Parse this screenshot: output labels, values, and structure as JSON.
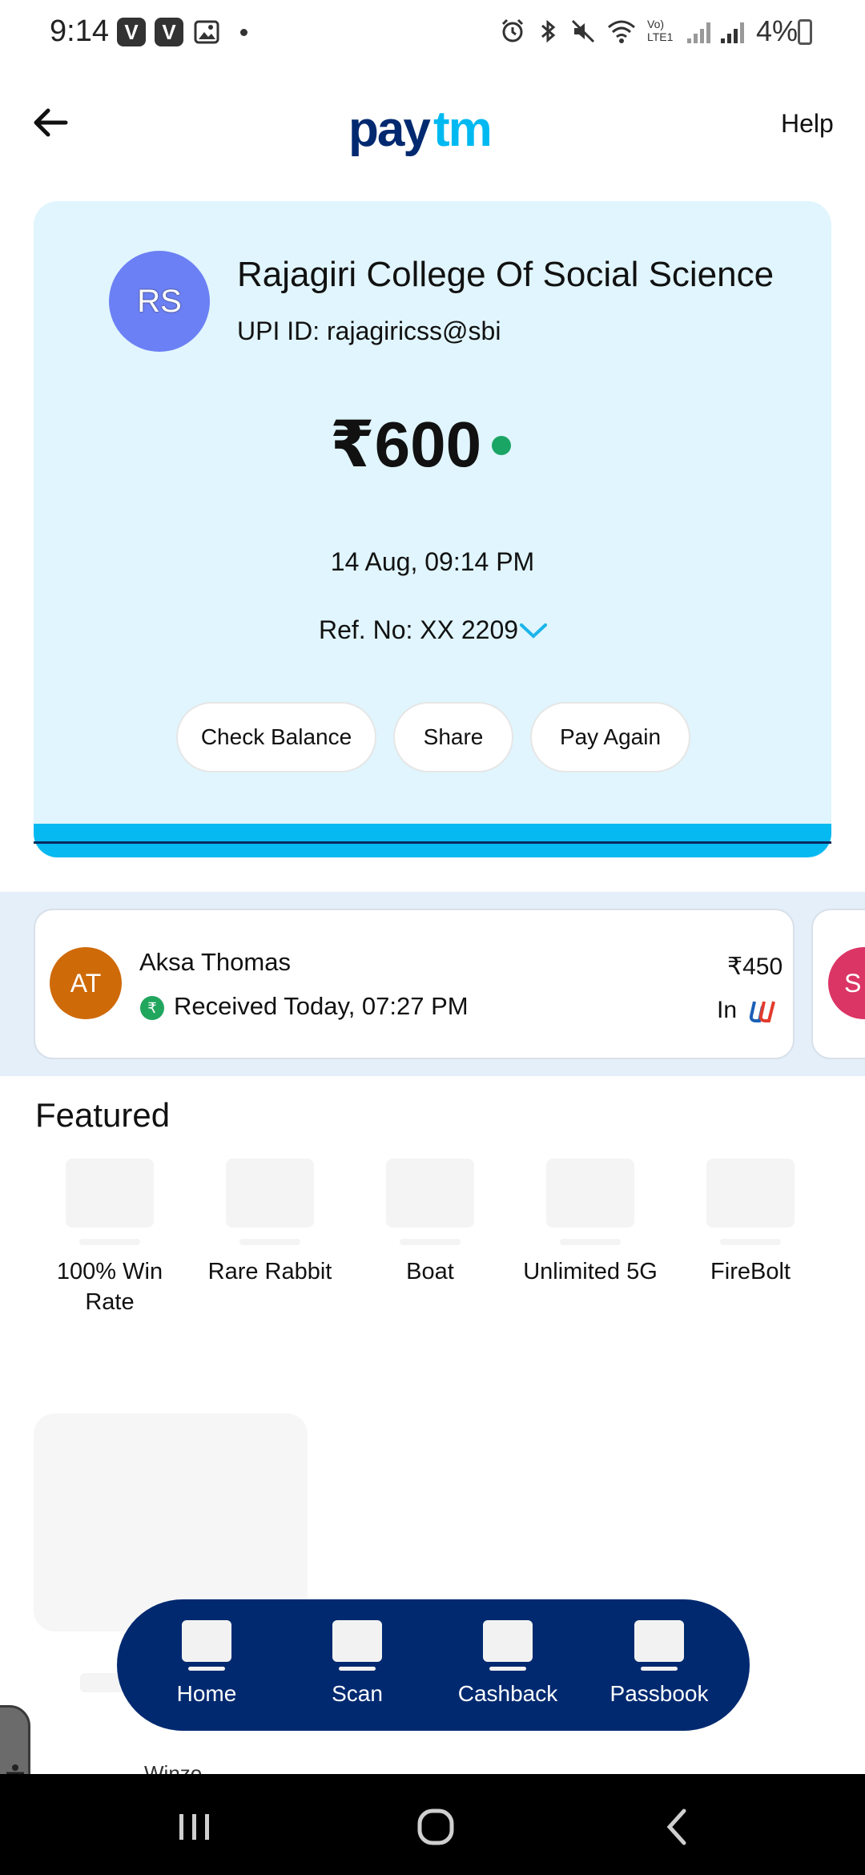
{
  "status_bar": {
    "time": "9:14",
    "notif_icons": [
      "V",
      "V"
    ],
    "battery": "4%"
  },
  "header": {
    "back_icon": "arrow-left-icon",
    "logo_text": "Paytm",
    "help": "Help"
  },
  "payment": {
    "avatar_initials": "RS",
    "avatar_color": "#6c80f5",
    "merchant_name": "Rajagiri College Of Social Science",
    "upi_id": "UPI ID: rajagiricss@sbi",
    "amount": "₹600",
    "status_color": "#1aa564",
    "datetime": "14 Aug, 09:14 PM",
    "ref": "Ref. No: XX 2209",
    "actions": [
      "Check Balance",
      "Share",
      "Pay Again"
    ]
  },
  "recent": {
    "name": "Aksa Thomas",
    "initials": "AT",
    "avatar_color": "#cf6a09",
    "status": "Received Today, 07:27 PM",
    "rupee_symbol": "₹",
    "amount": "₹450",
    "direction": "In",
    "peek_initials": "S"
  },
  "featured": {
    "title": "Featured",
    "items": [
      "100% Win Rate",
      "Rare Rabbit",
      "Boat",
      "Unlimited 5G",
      "FireBolt"
    ]
  },
  "below_fold_text": "Winzo",
  "bottom_nav": {
    "items": [
      "Home",
      "Scan",
      "Cashback",
      "Passbook"
    ],
    "background": "#002970"
  },
  "colors": {
    "card_bg": "#e0f5fd",
    "accent": "#06b9f0"
  }
}
